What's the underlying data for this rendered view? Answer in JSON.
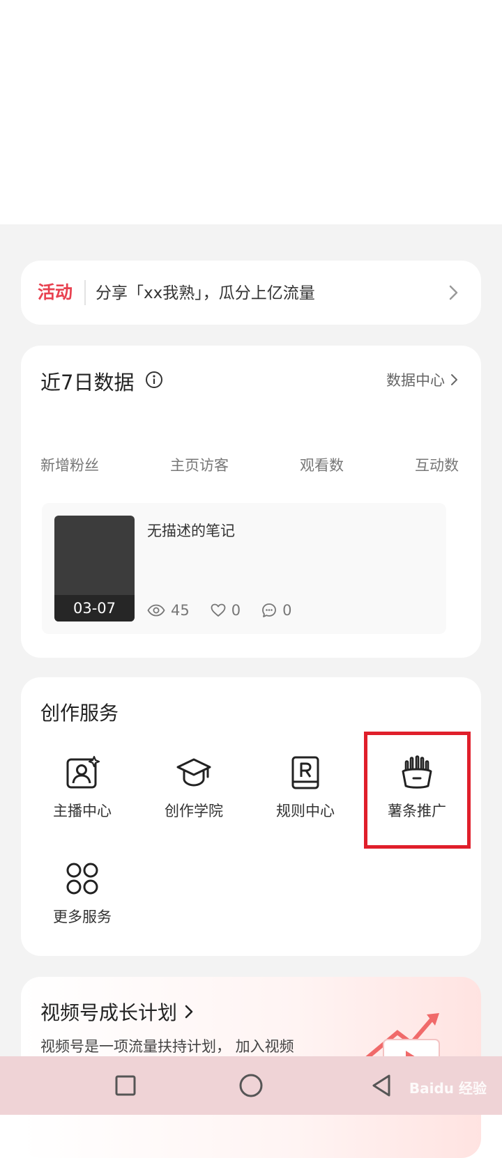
{
  "activity": {
    "tag": "活动",
    "text": "分享「xx我熟」，瓜分上亿流量"
  },
  "data_card": {
    "title": "近7日数据",
    "center_link": "数据中心",
    "metrics": [
      "新增粉丝",
      "主页访客",
      "观看数",
      "互动数"
    ],
    "note": {
      "title": "无描述的笔记",
      "date": "03-07",
      "views": "45",
      "likes": "0",
      "comments": "0"
    }
  },
  "services": {
    "title": "创作服务",
    "items": [
      {
        "label": "主播中心",
        "icon": "anchor-center-icon"
      },
      {
        "label": "创作学院",
        "icon": "graduation-cap-icon"
      },
      {
        "label": "规则中心",
        "icon": "rules-book-icon"
      },
      {
        "label": "薯条推广",
        "icon": "fries-icon"
      },
      {
        "label": "更多服务",
        "icon": "grid-circles-icon"
      }
    ]
  },
  "growth": {
    "title": "视频号成长计划",
    "desc": "视频号是一项流量扶持计划， 加入视频"
  },
  "navbar": {
    "watermark": "Baidu 经验"
  },
  "colors": {
    "accent": "#e8414f",
    "highlight": "#e01f2b",
    "nav_bg": "#efd3d6"
  }
}
